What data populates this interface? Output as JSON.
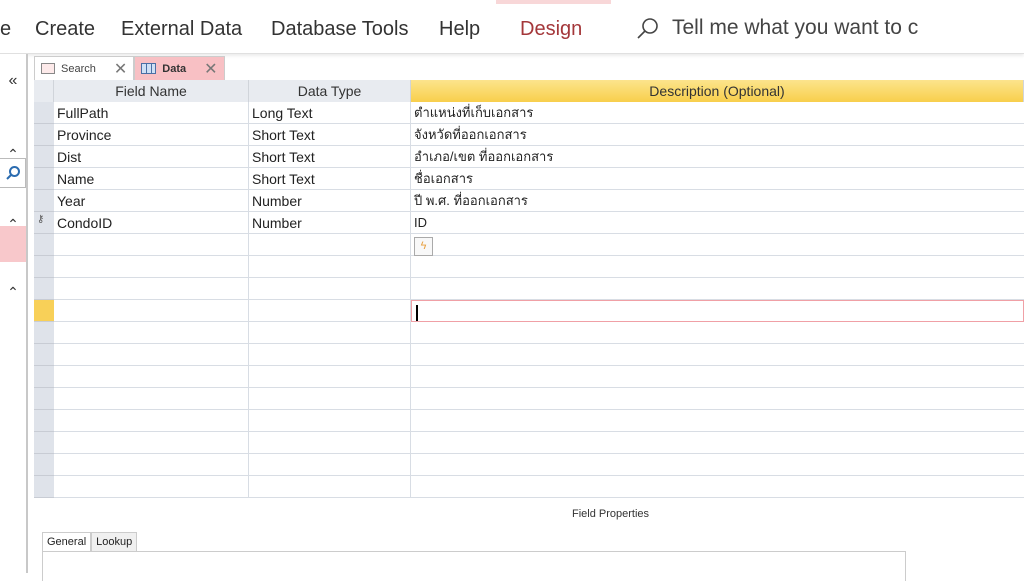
{
  "ribbon": {
    "tabs": [
      "e",
      "Create",
      "External Data",
      "Database Tools",
      "Help",
      "Design"
    ],
    "active": "Design",
    "tell_me": "Tell me what you want to c"
  },
  "doc_tabs": [
    {
      "label": "Search",
      "icon": "form-icon"
    },
    {
      "label": "Data",
      "icon": "table-icon",
      "active": true
    }
  ],
  "grid": {
    "headers": [
      "Field Name",
      "Data Type",
      "Description (Optional)"
    ],
    "rows": [
      {
        "name": "FullPath",
        "type": "Long Text",
        "desc": "ตำแหน่งที่เก็บเอกสาร"
      },
      {
        "name": "Province",
        "type": "Short Text",
        "desc": "จังหวัดที่ออกเอกสาร"
      },
      {
        "name": "Dist",
        "type": "Short Text",
        "desc": "อำเภอ/เขต ที่ออกเอกสาร"
      },
      {
        "name": "Name",
        "type": "Short Text",
        "desc": "ชื่อเอกสาร"
      },
      {
        "name": "Year",
        "type": "Number",
        "desc": "ปี พ.ศ. ที่ออกเอกสาร"
      },
      {
        "name": "CondoID",
        "type": "Number",
        "desc": "ID",
        "primary_key": true
      }
    ]
  },
  "field_properties": {
    "title": "Field Properties",
    "tabs": [
      "General",
      "Lookup"
    ],
    "active": "General"
  },
  "colors": {
    "accent": "#a4373a",
    "selected_tab": "#f8c0c4",
    "header_active": "#f8cf4c"
  }
}
